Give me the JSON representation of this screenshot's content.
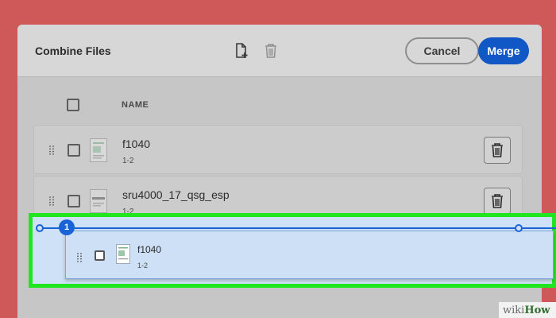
{
  "dialog": {
    "title": "Combine Files",
    "cancel_label": "Cancel",
    "merge_label": "Merge",
    "column_name": "NAME"
  },
  "files": [
    {
      "name": "f1040",
      "pages": "1-2"
    },
    {
      "name": "sru4000_17_qsg_esp",
      "pages": "1-2"
    }
  ],
  "dragged": {
    "name": "f1040",
    "pages": "1-2",
    "drop_index": "1"
  },
  "watermark": {
    "part1": "wiki",
    "part2": "How"
  },
  "colors": {
    "background": "#cf5858",
    "merge_button": "#1157c6",
    "highlight": "#20e620",
    "drop_indicator": "#1a63d6"
  },
  "icons": [
    "add-file-icon",
    "trash-icon",
    "grip-icon",
    "pdf-thumbnail-icon"
  ]
}
